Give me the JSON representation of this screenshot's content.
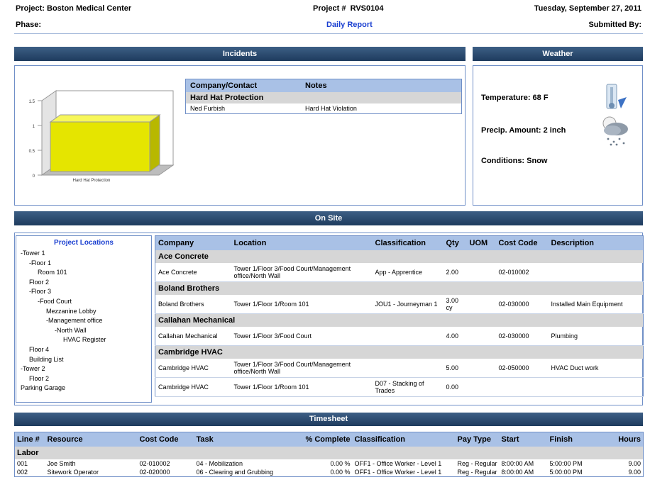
{
  "header": {
    "project": "Project: Boston Medical Center",
    "project_num": "Project #  RVS0104",
    "date": "Tuesday, September 27, 2011",
    "phase": "Phase:",
    "report": "Daily Report",
    "submitted": "Submitted By:"
  },
  "sections": {
    "incidents": "Incidents",
    "weather": "Weather",
    "onsite": "On Site",
    "timesheet": "Timesheet"
  },
  "incidents": {
    "chart_data": {
      "type": "bar",
      "categories": [
        "Hard Hat Protection"
      ],
      "values": [
        1
      ],
      "yticks": [
        "0",
        "0.5",
        "1",
        "1.5"
      ],
      "ylim": [
        0,
        1.5
      ],
      "bar_color": "#e5e500"
    },
    "table": {
      "headers": [
        "Company/Contact",
        "Notes"
      ],
      "group": "Hard Hat Protection",
      "rows": [
        [
          "Ned Furbish",
          "Hard Hat Violation"
        ]
      ]
    }
  },
  "weather": {
    "temperature": "Temperature: 68 F",
    "precip": "Precip. Amount: 2 inch",
    "conditions": "Conditions: Snow",
    "icons": [
      "thermometer-icon",
      "snow-cloud-icon"
    ]
  },
  "onsite": {
    "locations_title": "Project Locations",
    "locations": [
      {
        "label": "-Tower 1",
        "indent": 0
      },
      {
        "label": "-Floor 1",
        "indent": 1
      },
      {
        "label": "Room 101",
        "indent": 2
      },
      {
        "label": "Floor 2",
        "indent": 1
      },
      {
        "label": "-Floor 3",
        "indent": 1
      },
      {
        "label": "-Food Court",
        "indent": 2
      },
      {
        "label": "Mezzanine Lobby",
        "indent": 3
      },
      {
        "label": "-Management office",
        "indent": 3
      },
      {
        "label": "-North Wall",
        "indent": 4
      },
      {
        "label": "HVAC Register",
        "indent": 5
      },
      {
        "label": "Floor 4",
        "indent": 1
      },
      {
        "label": "Building List",
        "indent": 1
      },
      {
        "label": "-Tower 2",
        "indent": 0
      },
      {
        "label": "Floor 2",
        "indent": 1
      },
      {
        "label": "Parking Garage",
        "indent": 0
      }
    ],
    "headers": [
      "Company",
      "Location",
      "Classification",
      "Qty",
      "UOM",
      "Cost Code",
      "Description"
    ],
    "groups": [
      {
        "name": "Ace Concrete",
        "rows": [
          [
            "Ace Concrete",
            "Tower 1/Floor 3/Food Court/Management office/North Wall",
            "App - Apprentice",
            "2.00",
            "",
            "02-010002",
            ""
          ]
        ]
      },
      {
        "name": "Boland Brothers",
        "rows": [
          [
            "Boland Brothers",
            "Tower 1/Floor 1/Room 101",
            "JOU1 - Journeyman 1",
            "3.00 cy",
            "",
            "02-030000",
            "Installed Main Equipment"
          ]
        ]
      },
      {
        "name": "Callahan Mechanical",
        "rows": [
          [
            "Callahan Mechanical",
            "Tower 1/Floor 3/Food Court",
            "",
            "4.00",
            "",
            "02-030000",
            "Plumbing"
          ]
        ]
      },
      {
        "name": "Cambridge HVAC",
        "rows": [
          [
            "Cambridge HVAC",
            "Tower 1/Floor 3/Food Court/Management office/North Wall",
            "",
            "5.00",
            "",
            "02-050000",
            "HVAC Duct work"
          ],
          [
            "Cambridge HVAC",
            "Tower 1/Floor 1/Room 101",
            "D07 - Stacking of Trades",
            "0.00",
            "",
            "",
            ""
          ]
        ]
      }
    ]
  },
  "timesheet": {
    "headers": [
      "Line #",
      "Resource",
      "Cost Code",
      "Task",
      "% Complete",
      "Classification",
      "Pay Type",
      "Start",
      "Finish",
      "Hours"
    ],
    "group": "Labor",
    "rows": [
      [
        "001",
        "Joe Smith",
        "02-010002",
        "04 - Mobilization",
        "0.00 %",
        "OFF1 - Office Worker - Level 1",
        "Reg - Regular",
        "8:00:00 AM",
        "5:00:00 PM",
        "9.00"
      ],
      [
        "002",
        "Sitework Operator",
        "02-020000",
        "06 - Clearing and Grubbing",
        "0.00 %",
        "OFF1 - Office Worker - Level 1",
        "Reg - Regular",
        "8:00:00 AM",
        "5:00:00 PM",
        "9.00"
      ]
    ]
  }
}
